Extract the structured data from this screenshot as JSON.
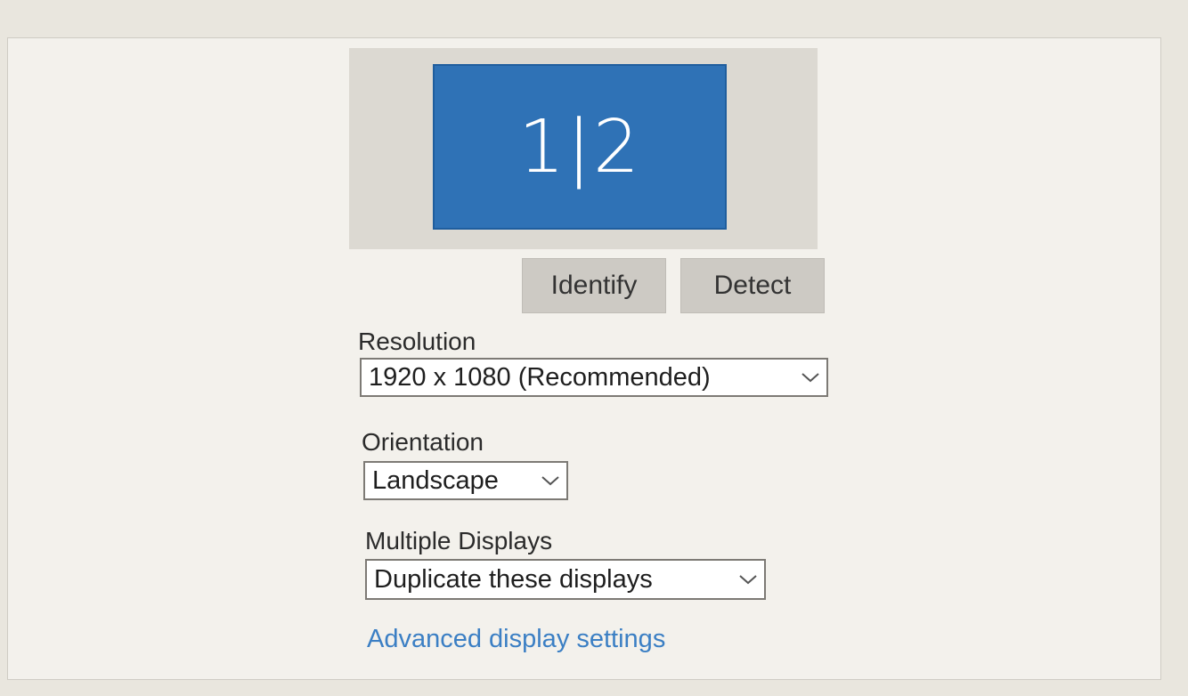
{
  "display_preview": {
    "monitor_label": "1|2",
    "monitor_color": "#2f72b6"
  },
  "buttons": {
    "identify_label": "Identify",
    "detect_label": "Detect"
  },
  "resolution": {
    "label": "Resolution",
    "value": "1920 x 1080 (Recommended)"
  },
  "orientation": {
    "label": "Orientation",
    "value": "Landscape"
  },
  "multiple_displays": {
    "label": "Multiple Displays",
    "value": "Duplicate these displays"
  },
  "advanced_link": {
    "label": "Advanced display settings",
    "color": "#3b7fc4"
  },
  "icons": {
    "dropdown": "chevron-down-icon"
  }
}
